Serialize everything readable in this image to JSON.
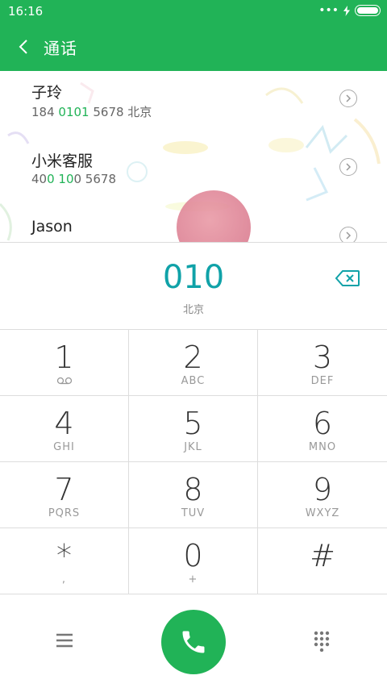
{
  "status": {
    "time": "16:16",
    "dots": "•••",
    "charge_icon": "bolt-icon",
    "battery_icon": "battery-icon"
  },
  "header": {
    "title": "通话",
    "back_icon": "chevron-left-icon"
  },
  "contacts": [
    {
      "name": "子玲",
      "num_pre": "184 ",
      "num_hl": "0101",
      "num_post": " 5678  北京"
    },
    {
      "name": "小米客服",
      "num_pre": "40",
      "num_hl": "0 10",
      "num_post": "0 5678"
    },
    {
      "name": "Jason",
      "num_pre": "",
      "num_hl": "",
      "num_post": ""
    }
  ],
  "entry": {
    "digits": "010",
    "region": "北京",
    "backspace_icon": "backspace-icon"
  },
  "keypad": [
    {
      "digit": "1",
      "letters": ""
    },
    {
      "digit": "2",
      "letters": "ABC"
    },
    {
      "digit": "3",
      "letters": "DEF"
    },
    {
      "digit": "4",
      "letters": "GHI"
    },
    {
      "digit": "5",
      "letters": "JKL"
    },
    {
      "digit": "6",
      "letters": "MNO"
    },
    {
      "digit": "7",
      "letters": "PQRS"
    },
    {
      "digit": "8",
      "letters": "TUV"
    },
    {
      "digit": "9",
      "letters": "WXYZ"
    },
    {
      "digit": "*",
      "letters": ","
    },
    {
      "digit": "0",
      "letters": "+"
    },
    {
      "digit": "#",
      "letters": ""
    }
  ],
  "bottom": {
    "menu_icon": "menu-icon",
    "call_icon": "phone-icon",
    "dialpad_icon": "dialpad-icon"
  },
  "colors": {
    "accent": "#21b357",
    "digits": "#10a2a8"
  }
}
